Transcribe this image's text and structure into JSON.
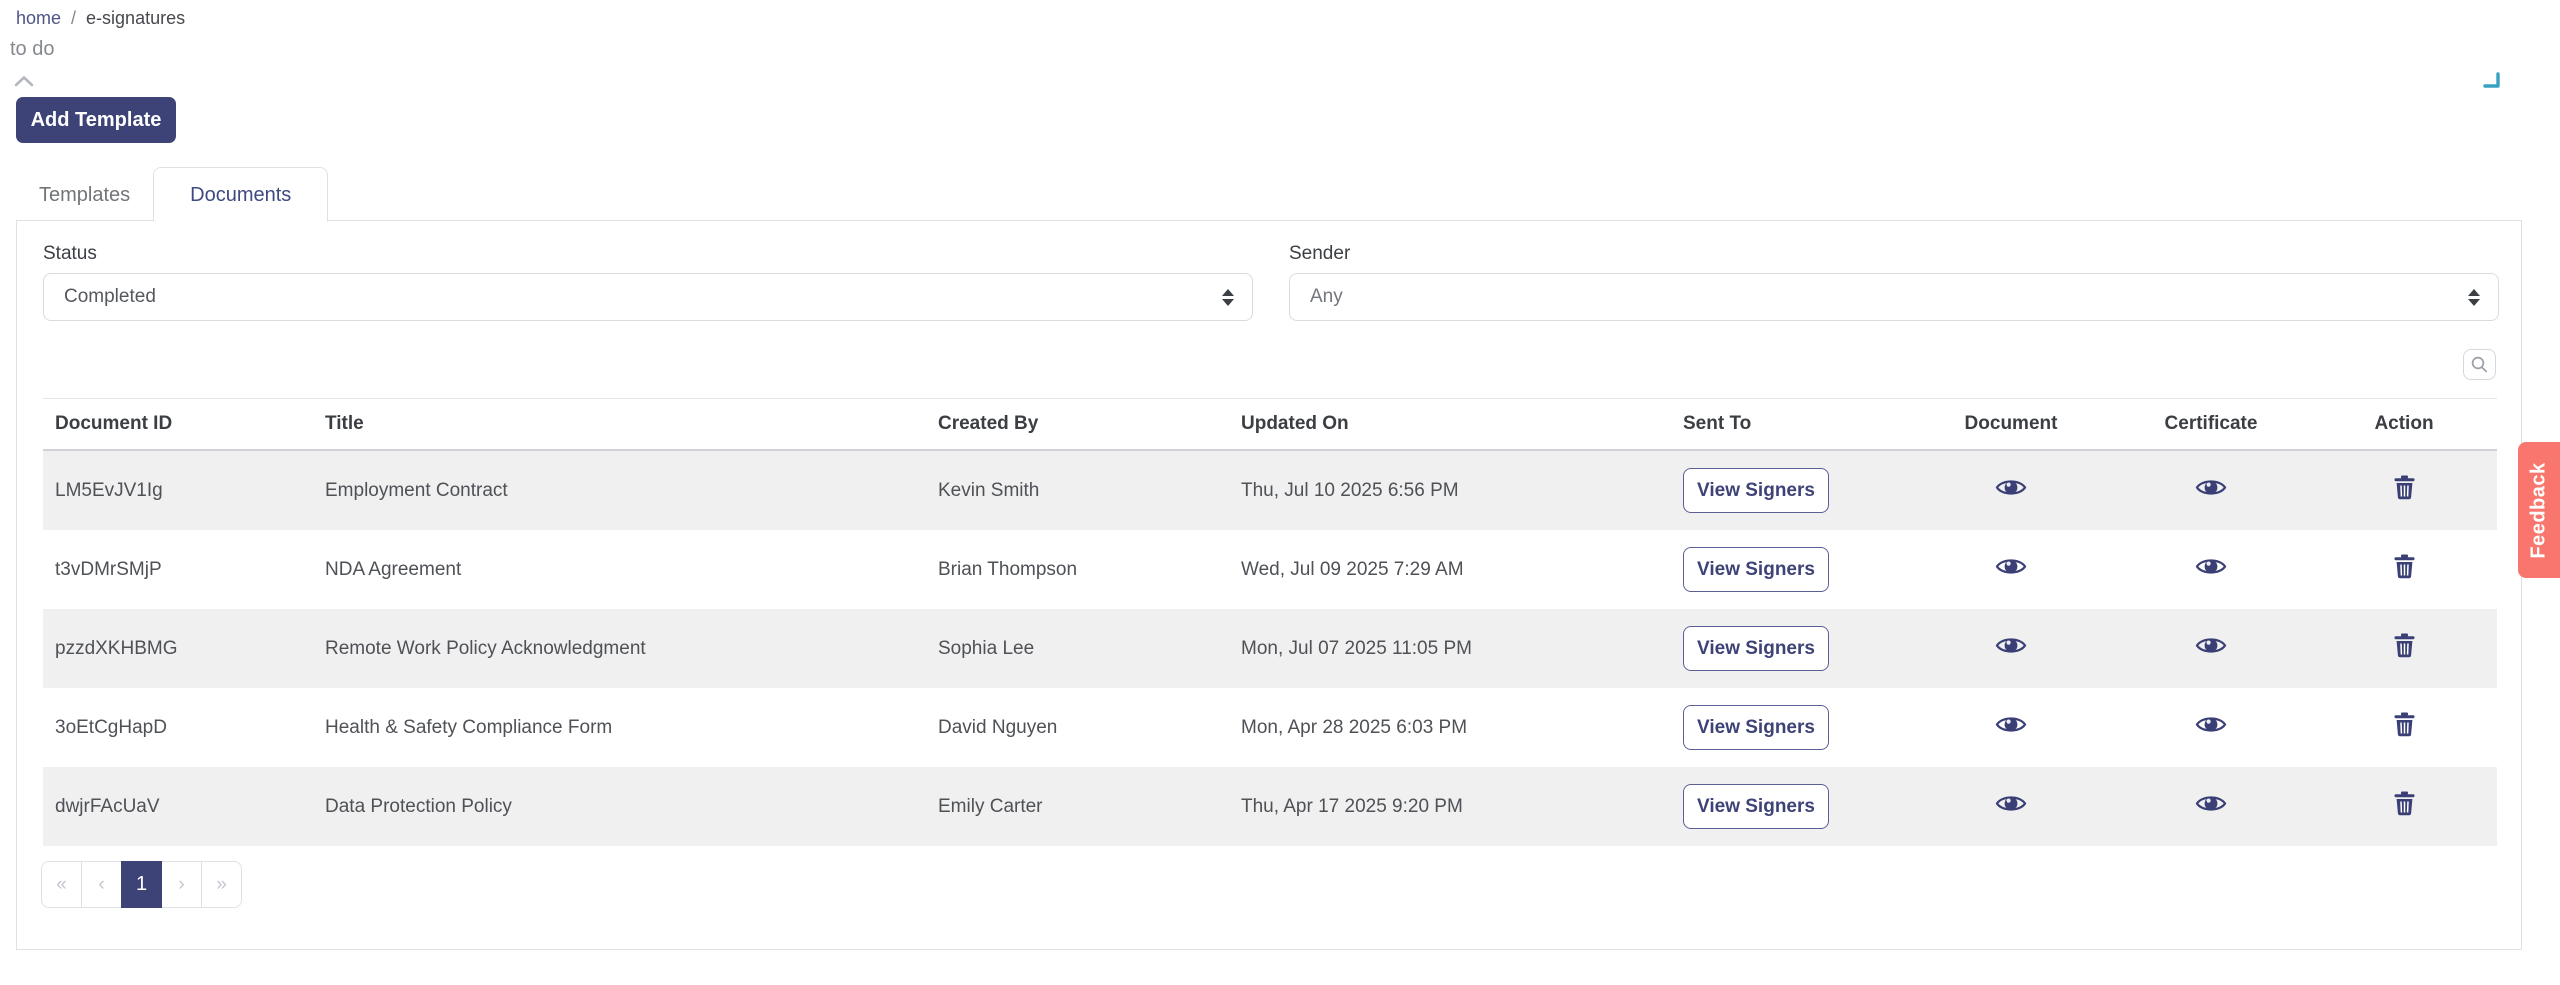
{
  "breadcrumb": {
    "separator": "/",
    "items": [
      {
        "label": "home"
      },
      {
        "label": "e-signatures"
      }
    ]
  },
  "subtitle": "to do",
  "toolbar": {
    "add_template_label": "Add Template"
  },
  "tabs": {
    "templates_label": "Templates",
    "documents_label": "Documents",
    "active": "Documents"
  },
  "filters": {
    "status_label": "Status",
    "status_value": "Completed",
    "sender_label": "Sender",
    "sender_value": "Any"
  },
  "table": {
    "headers": {
      "document_id": "Document ID",
      "title": "Title",
      "created_by": "Created By",
      "updated_on": "Updated On",
      "sent_to": "Sent To",
      "document": "Document",
      "certificate": "Certificate",
      "action": "Action"
    },
    "view_signers_label": "View Signers",
    "rows": [
      {
        "id": "LM5EvJV1Ig",
        "title": "Employment Contract",
        "created_by": "Kevin Smith",
        "updated_on": "Thu, Jul 10 2025 6:56 PM"
      },
      {
        "id": "t3vDMrSMjP",
        "title": "NDA Agreement",
        "created_by": "Brian Thompson",
        "updated_on": "Wed, Jul 09 2025 7:29 AM"
      },
      {
        "id": "pzzdXKHBMG",
        "title": "Remote Work Policy Acknowledgment",
        "created_by": "Sophia Lee",
        "updated_on": "Mon, Jul 07 2025 11:05 PM"
      },
      {
        "id": "3oEtCgHapD",
        "title": "Health & Safety Compliance Form",
        "created_by": "David Nguyen",
        "updated_on": "Mon, Apr 28 2025 6:03 PM"
      },
      {
        "id": "dwjrFAcUaV",
        "title": "Data Protection Policy",
        "created_by": "Emily Carter",
        "updated_on": "Thu, Apr 17 2025 9:20 PM"
      }
    ]
  },
  "pagination": {
    "first_label": "«",
    "prev_label": "‹",
    "current_page": "1",
    "next_label": "›",
    "last_label": "»"
  },
  "feedback": {
    "label": "Feedback"
  },
  "icons": {
    "search": "search-icon",
    "view": "eye-icon",
    "delete": "trash-icon",
    "select_sort": "up-down-arrows-icon",
    "collapse": "chevron-up-icon",
    "corner": "corner-arrow-icon"
  },
  "colors": {
    "primary_indigo": "#3e4377",
    "feedback_coral": "#f8766d",
    "row_stripe": "#f0f0f0",
    "border": "#dee2e6",
    "icon_navy": "#3a3f75",
    "corner_teal": "#38a1c2"
  }
}
